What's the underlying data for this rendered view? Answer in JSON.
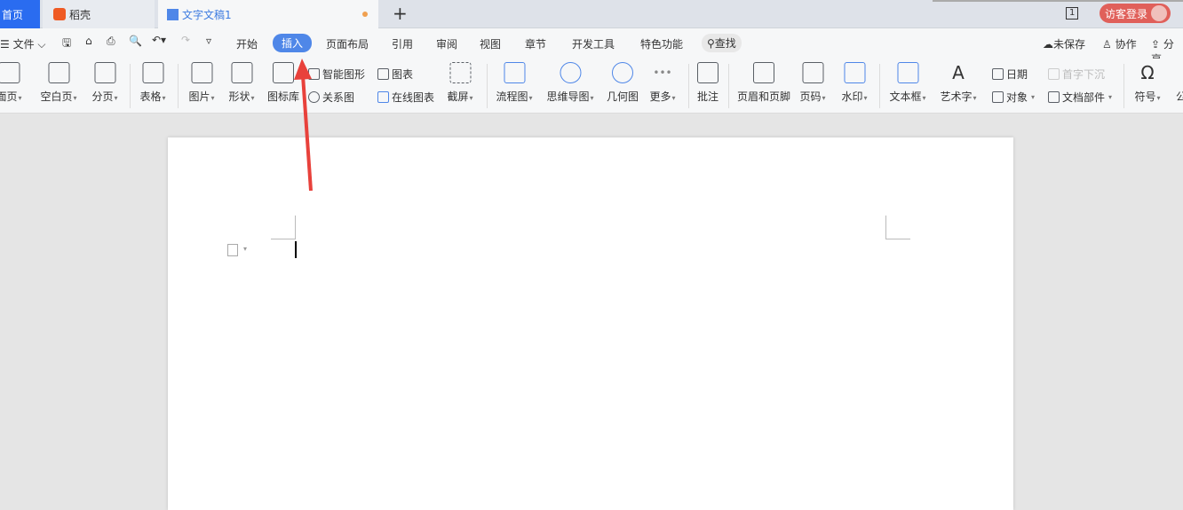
{
  "tabs": [
    {
      "label": "首页"
    },
    {
      "label": "稻壳"
    },
    {
      "label": "文字文稿1"
    }
  ],
  "new_tab": "+",
  "page_counter": "1",
  "login": "访客登录",
  "toolbar": {
    "file": "文件",
    "menu": [
      "开始",
      "插入",
      "页面布局",
      "引用",
      "审阅",
      "视图",
      "章节",
      "开发工具",
      "特色功能"
    ],
    "search": "查找",
    "unsaved": "未保存",
    "collab": "协作",
    "share": "分享"
  },
  "ribbon": {
    "big": [
      "面页",
      "空白页",
      "分页",
      "表格",
      "图片",
      "形状",
      "图标库",
      "截屏",
      "流程图",
      "思维导图",
      "几何图",
      "更多",
      "批注",
      "页眉和页脚",
      "页码",
      "水印",
      "文本框",
      "艺术字",
      "符号",
      "公"
    ],
    "small": [
      "智能图形",
      "关系图",
      "图表",
      "在线图表",
      "日期",
      "对象",
      "首字下沉",
      "文档部件"
    ]
  },
  "colors": {
    "home_tab": "#2a6cf0",
    "active_menu": "#4f87e8",
    "login": "#e0605a",
    "arrow": "#e8413b"
  }
}
